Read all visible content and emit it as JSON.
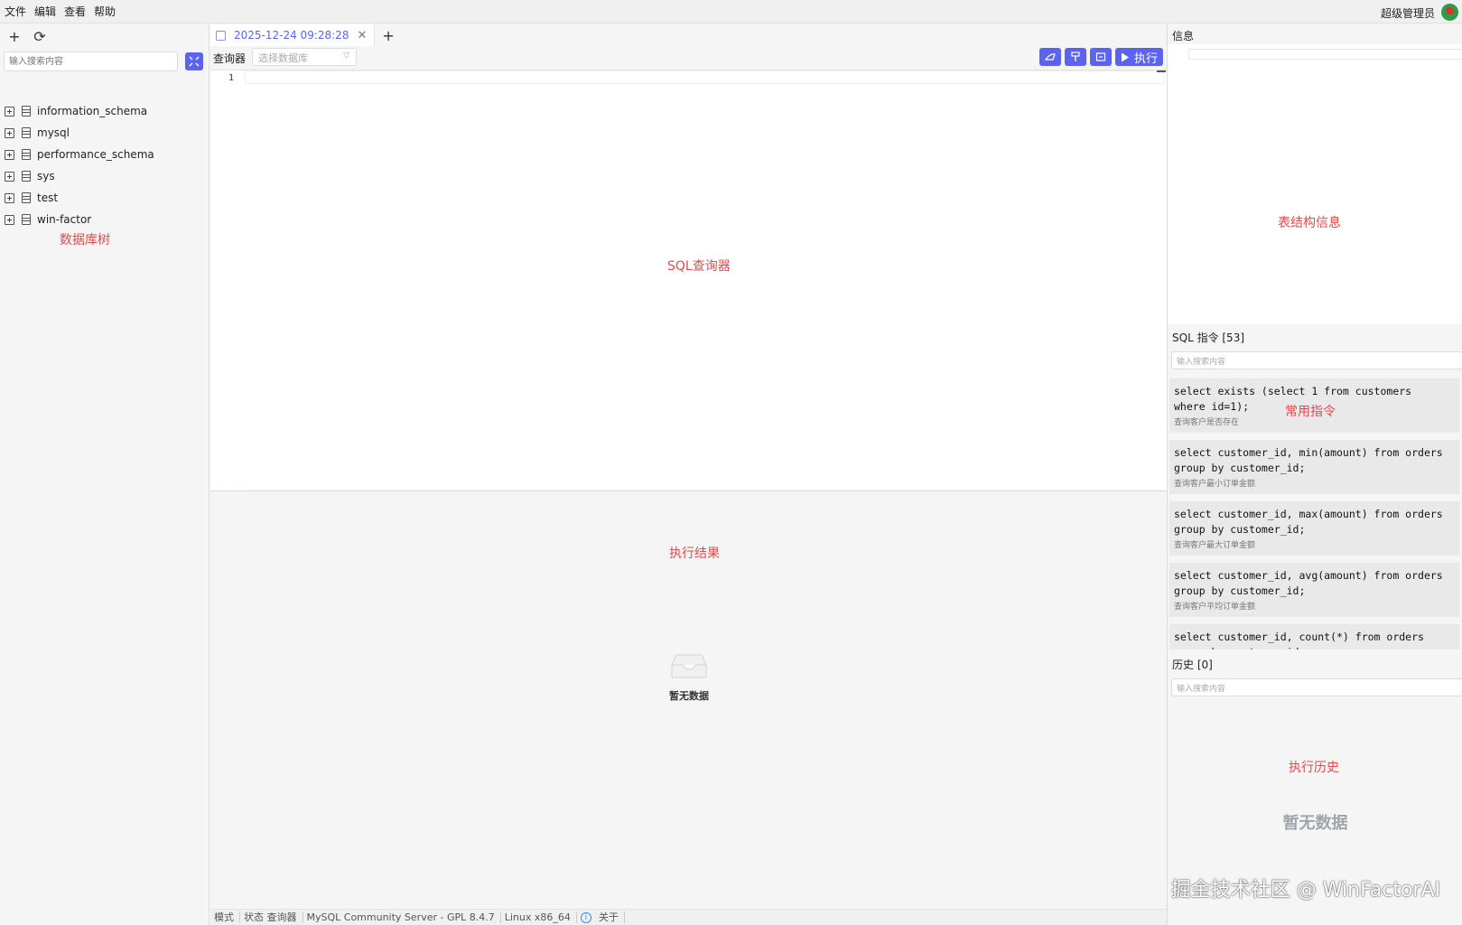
{
  "menu": [
    "文件",
    "编辑",
    "查看",
    "帮助"
  ],
  "user": {
    "name": "超级管理员",
    "avatar_icon": "user-avatar"
  },
  "sidebar": {
    "search_placeholder": "输入搜索内容",
    "databases": [
      "information_schema",
      "mysql",
      "performance_schema",
      "sys",
      "test",
      "win-factor"
    ],
    "annotation": "数据库树"
  },
  "editor": {
    "tab_label": "2025-12-24 09:28:28",
    "query_label": "查询器",
    "db_select_placeholder": "选择数据库",
    "run_label": "执行",
    "line_number": "1",
    "annotation": "SQL查询器"
  },
  "results": {
    "annotation": "执行结果",
    "empty_text": "暂无数据"
  },
  "status": {
    "mode": "模式",
    "state": "状态 查询器",
    "server": "MySQL Community Server - GPL 8.4.7",
    "platform": "Linux x86_64",
    "about": "关于"
  },
  "right": {
    "info_title": "信息",
    "info_annotation": "表结构信息",
    "commands_title": "SQL 指令 [53]",
    "commands_search_placeholder": "输入搜索内容",
    "commands_annotation": "常用指令",
    "commands": [
      {
        "code": "select exists (select 1 from customers\nwhere id=1);",
        "desc": "查询客户是否存在"
      },
      {
        "code": "select customer_id, min(amount) from orders\ngroup by customer_id;",
        "desc": "查询客户最小订单金额"
      },
      {
        "code": "select customer_id, max(amount) from orders\ngroup by customer_id;",
        "desc": "查询客户最大订单金额"
      },
      {
        "code": "select customer_id, avg(amount) from orders\ngroup by customer_id;",
        "desc": "查询客户平均订单金额"
      },
      {
        "code": "select customer_id, count(*) from orders\ngroup by customer_id;",
        "desc": ""
      }
    ],
    "history_title": "历史 [0]",
    "history_search_placeholder": "输入搜索内容",
    "history_annotation": "执行历史",
    "history_empty": "暂无数据"
  },
  "watermark": "掘金技术社区 @ WinFactorAI",
  "colors": {
    "accent": "#5b63f0",
    "annotation": "#e5484d"
  }
}
